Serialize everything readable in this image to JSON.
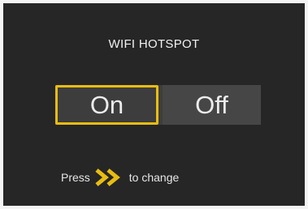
{
  "screen": {
    "title": "WIFI HOTSPOT",
    "toggle": {
      "on_label": "On",
      "off_label": "Off",
      "selected": "On"
    },
    "hint": {
      "before": "Press",
      "icon": "double-chevron-right-icon",
      "after": "to change"
    }
  },
  "colors": {
    "background": "#262626",
    "accent": "#e8bd12",
    "text": "#f2f2f2",
    "toggle_bg": "#3d3d3d"
  }
}
